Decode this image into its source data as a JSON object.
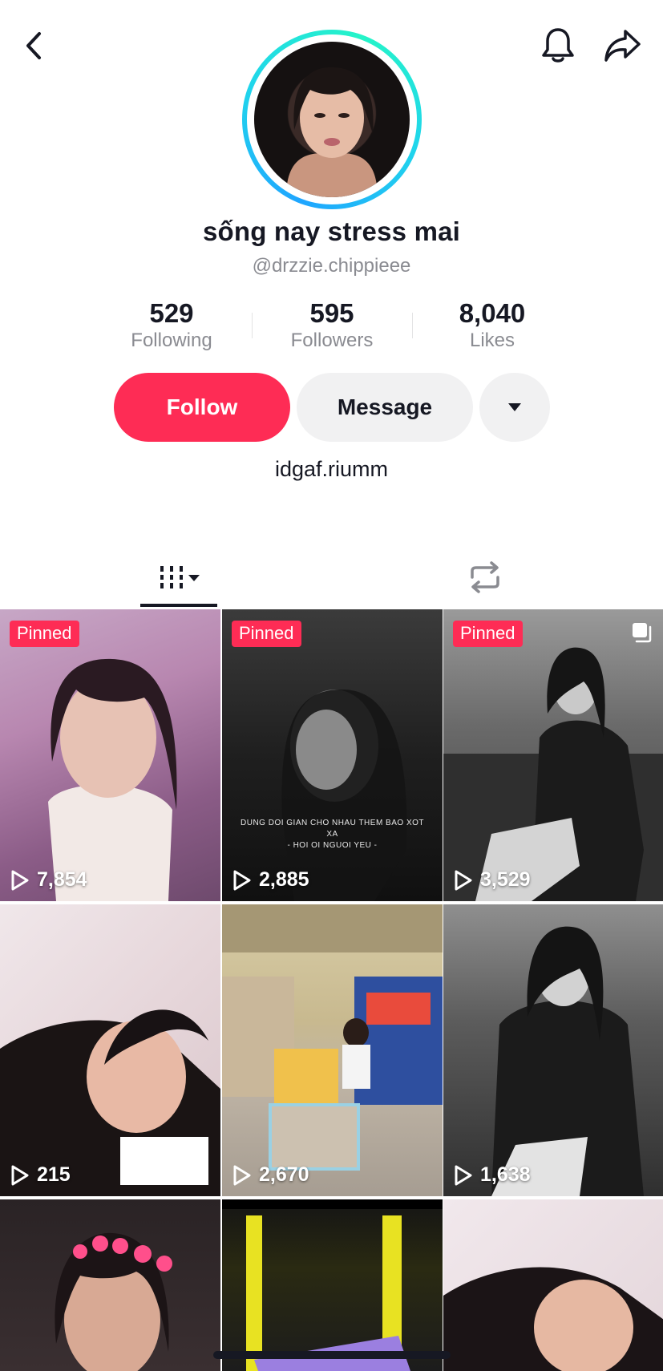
{
  "profile": {
    "display_name": "sống nay stress mai",
    "handle": "@drzzie.chippieee",
    "bio": "idgaf.riumm"
  },
  "stats": [
    {
      "value": "529",
      "label": "Following"
    },
    {
      "value": "595",
      "label": "Followers"
    },
    {
      "value": "8,040",
      "label": "Likes"
    }
  ],
  "actions": {
    "follow_label": "Follow",
    "message_label": "Message"
  },
  "icons": {
    "back": "back-chevron-icon",
    "bell": "bell-icon",
    "share": "share-arrow-icon",
    "more": "caret-down-icon",
    "videos_tab": "grid-bars-icon",
    "reposts_tab": "repost-icon",
    "play": "play-icon",
    "multi": "multi-photo-icon"
  },
  "colors": {
    "accent": "#fe2c55",
    "ring_start": "#1fa5ff",
    "ring_end": "#25f4c8",
    "secondary_button": "#f1f1f2"
  },
  "videos": [
    {
      "views": "7,854",
      "pinned": "Pinned"
    },
    {
      "views": "2,885",
      "pinned": "Pinned",
      "caption_line1": "DUNG DOI GIAN CHO NHAU THEM BAO XOT XA",
      "caption_line2": "- HOI OI NGUOI YEU -"
    },
    {
      "views": "3,529",
      "pinned": "Pinned"
    },
    {
      "views": "215"
    },
    {
      "views": "2,670"
    },
    {
      "views": "1,638"
    },
    {
      "views": ""
    },
    {
      "views": ""
    },
    {
      "views": ""
    }
  ]
}
